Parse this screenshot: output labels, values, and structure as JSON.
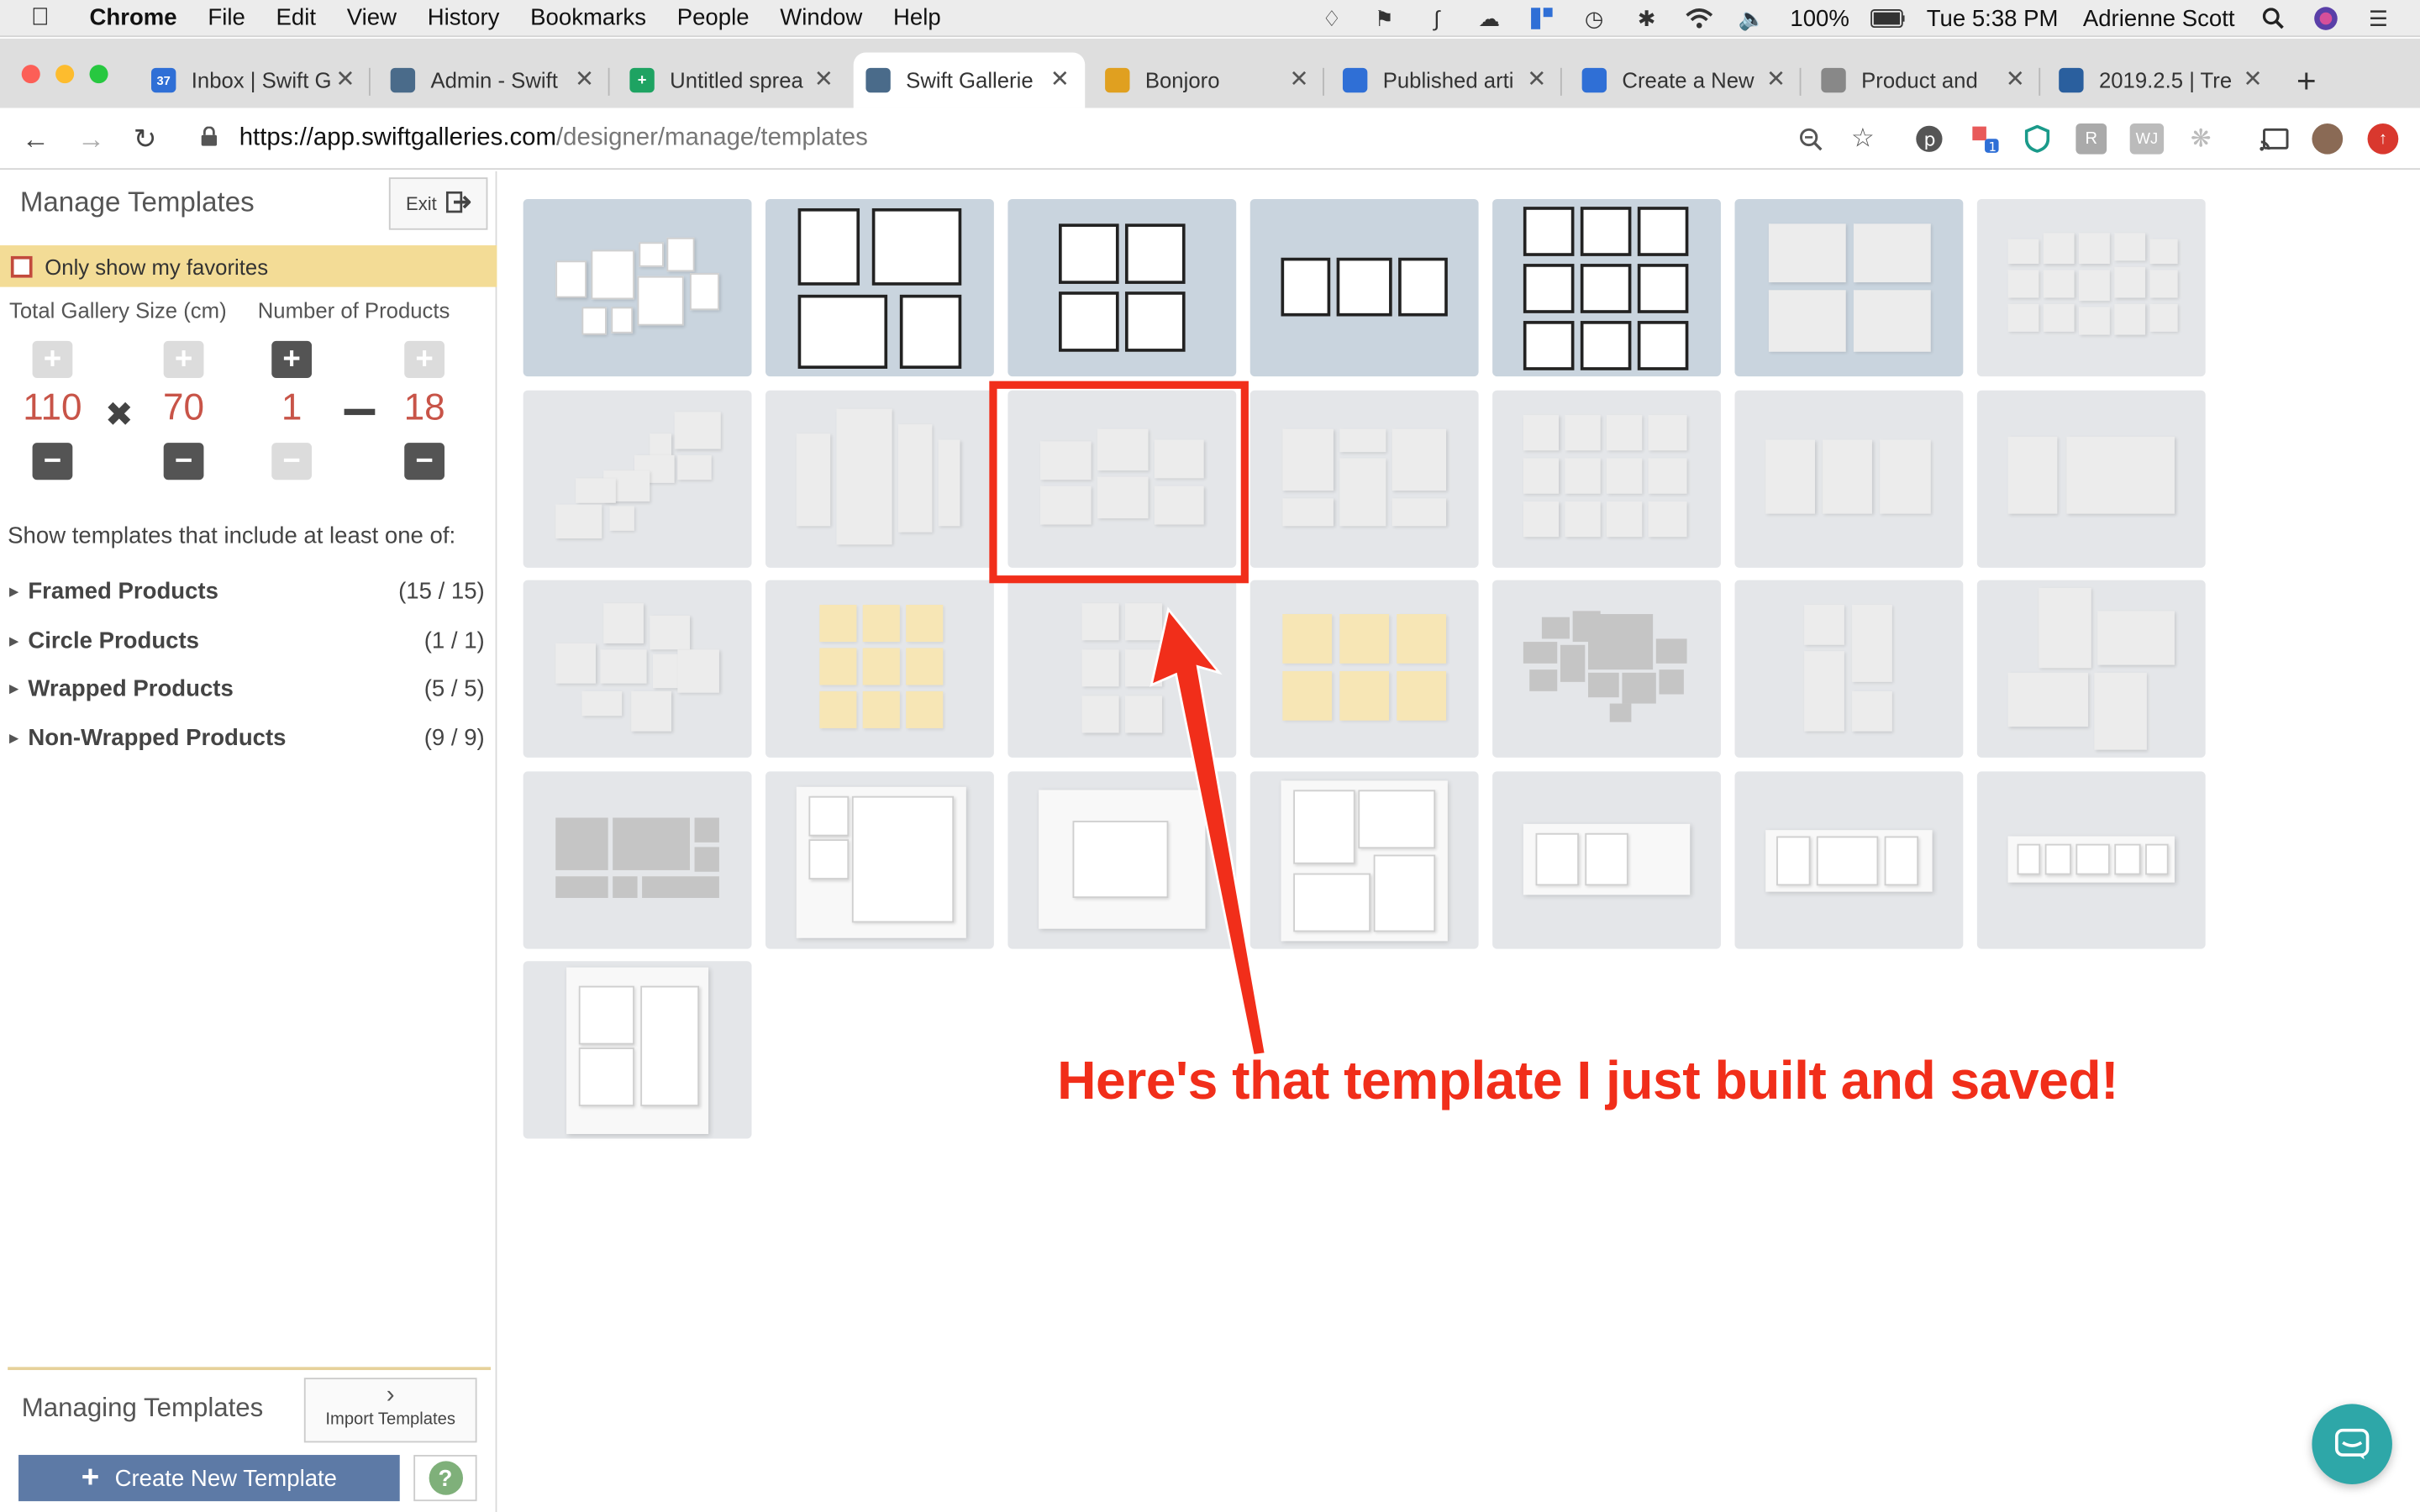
{
  "menubar": {
    "app": "Chrome",
    "items": [
      "File",
      "Edit",
      "View",
      "History",
      "Bookmarks",
      "People",
      "Window",
      "Help"
    ],
    "battery": "100%",
    "clock": "Tue 5:38 PM",
    "user": "Adrienne Scott"
  },
  "tabs": [
    {
      "label": "Inbox | Swift G",
      "favicon_color": "#2f6fd6",
      "favicon": "37"
    },
    {
      "label": "Admin - Swift",
      "favicon_color": "#4a6b8a",
      "favicon": ""
    },
    {
      "label": "Untitled sprea",
      "favicon_color": "#1ea362",
      "favicon": "+"
    },
    {
      "label": "Swift Gallerie",
      "favicon_color": "#4a6b8a",
      "favicon": ""
    },
    {
      "label": "Bonjoro",
      "favicon_color": "#e0a020",
      "favicon": ""
    },
    {
      "label": "Published arti",
      "favicon_color": "#2f6fd6",
      "favicon": ""
    },
    {
      "label": "Create a New",
      "favicon_color": "#2f6fd6",
      "favicon": ""
    },
    {
      "label": "Product and",
      "favicon_color": "#888888",
      "favicon": ""
    },
    {
      "label": "2019.2.5 | Tre",
      "favicon_color": "#2a5f9e",
      "favicon": ""
    }
  ],
  "address": {
    "host": "https://app.swiftgalleries.com",
    "path": "/designer/manage/templates"
  },
  "panel": {
    "title": "Manage Templates",
    "exit_label": "Exit",
    "favorites_label": "Only show my favorites",
    "gallery_size_label": "Total Gallery Size (cm)",
    "products_label": "Number of Products",
    "width_value": "110",
    "height_value": "70",
    "min_products": "1",
    "max_products": "18",
    "show_label": "Show templates that include at least one of:",
    "categories": [
      {
        "label": "Framed Products",
        "count": "(15 / 15)"
      },
      {
        "label": "Circle Products",
        "count": "(1 / 1)"
      },
      {
        "label": "Wrapped Products",
        "count": "(5 / 5)"
      },
      {
        "label": "Non-Wrapped Products",
        "count": "(9 / 9)"
      }
    ],
    "managing_label": "Managing Templates",
    "import_label": "Import Templates",
    "create_label": "Create New Template",
    "help_label": "?"
  },
  "annotation": {
    "text": "Here's that template I just built and saved!",
    "color": "#f12e1a"
  },
  "colors": {
    "accent_button": "#5d7aa6",
    "value_red": "#c85448",
    "favorites_bar": "#f3dc96",
    "chat": "#2ea7a8"
  }
}
